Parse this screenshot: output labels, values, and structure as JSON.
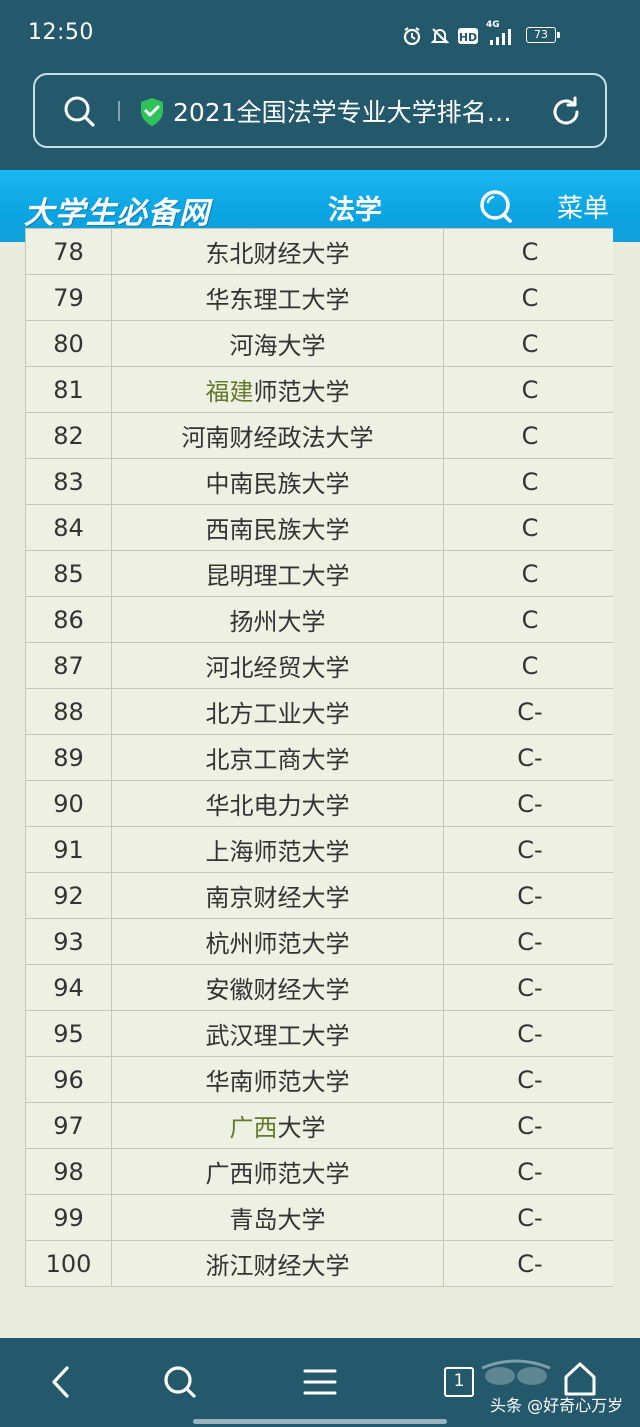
{
  "status_bar": {
    "time": "12:50",
    "network": "4G",
    "battery": "73"
  },
  "address_bar": {
    "page_title": "2021全国法学专业大学排名…"
  },
  "site_header": {
    "logo": "大学生必备网",
    "section": "法学",
    "menu_label": "菜单"
  },
  "ranking_table": {
    "rows": [
      {
        "rank": "78",
        "name": "东北财经大学",
        "grade": "C"
      },
      {
        "rank": "79",
        "name": "华东理工大学",
        "grade": "C"
      },
      {
        "rank": "80",
        "name": "河海大学",
        "grade": "C"
      },
      {
        "rank": "81",
        "name_link": "福建",
        "name_rest": "师范大学",
        "grade": "C"
      },
      {
        "rank": "82",
        "name": "河南财经政法大学",
        "grade": "C"
      },
      {
        "rank": "83",
        "name": "中南民族大学",
        "grade": "C"
      },
      {
        "rank": "84",
        "name": "西南民族大学",
        "grade": "C"
      },
      {
        "rank": "85",
        "name": "昆明理工大学",
        "grade": "C"
      },
      {
        "rank": "86",
        "name": "扬州大学",
        "grade": "C"
      },
      {
        "rank": "87",
        "name": "河北经贸大学",
        "grade": "C"
      },
      {
        "rank": "88",
        "name": "北方工业大学",
        "grade": "C-"
      },
      {
        "rank": "89",
        "name": "北京工商大学",
        "grade": "C-"
      },
      {
        "rank": "90",
        "name": "华北电力大学",
        "grade": "C-"
      },
      {
        "rank": "91",
        "name": "上海师范大学",
        "grade": "C-"
      },
      {
        "rank": "92",
        "name": "南京财经大学",
        "grade": "C-"
      },
      {
        "rank": "93",
        "name": "杭州师范大学",
        "grade": "C-"
      },
      {
        "rank": "94",
        "name": "安徽财经大学",
        "grade": "C-"
      },
      {
        "rank": "95",
        "name": "武汉理工大学",
        "grade": "C-"
      },
      {
        "rank": "96",
        "name": "华南师范大学",
        "grade": "C-"
      },
      {
        "rank": "97",
        "name_link": "广西",
        "name_rest": "大学",
        "grade": "C-"
      },
      {
        "rank": "98",
        "name": "广西师范大学",
        "grade": "C-"
      },
      {
        "rank": "99",
        "name": "青岛大学",
        "grade": "C-"
      },
      {
        "rank": "100",
        "name": "浙江财经大学",
        "grade": "C-"
      }
    ]
  },
  "bottom_nav": {
    "tab_count": "1",
    "watermark": "头条 @好奇心万岁"
  },
  "colors": {
    "chrome": "#24596c",
    "header_blue": "#0ba4e2",
    "page_bg": "#e9ecdd",
    "table_border": "#c2c8b4",
    "link_green": "#667a2c",
    "secure_green": "#2fc25b"
  }
}
